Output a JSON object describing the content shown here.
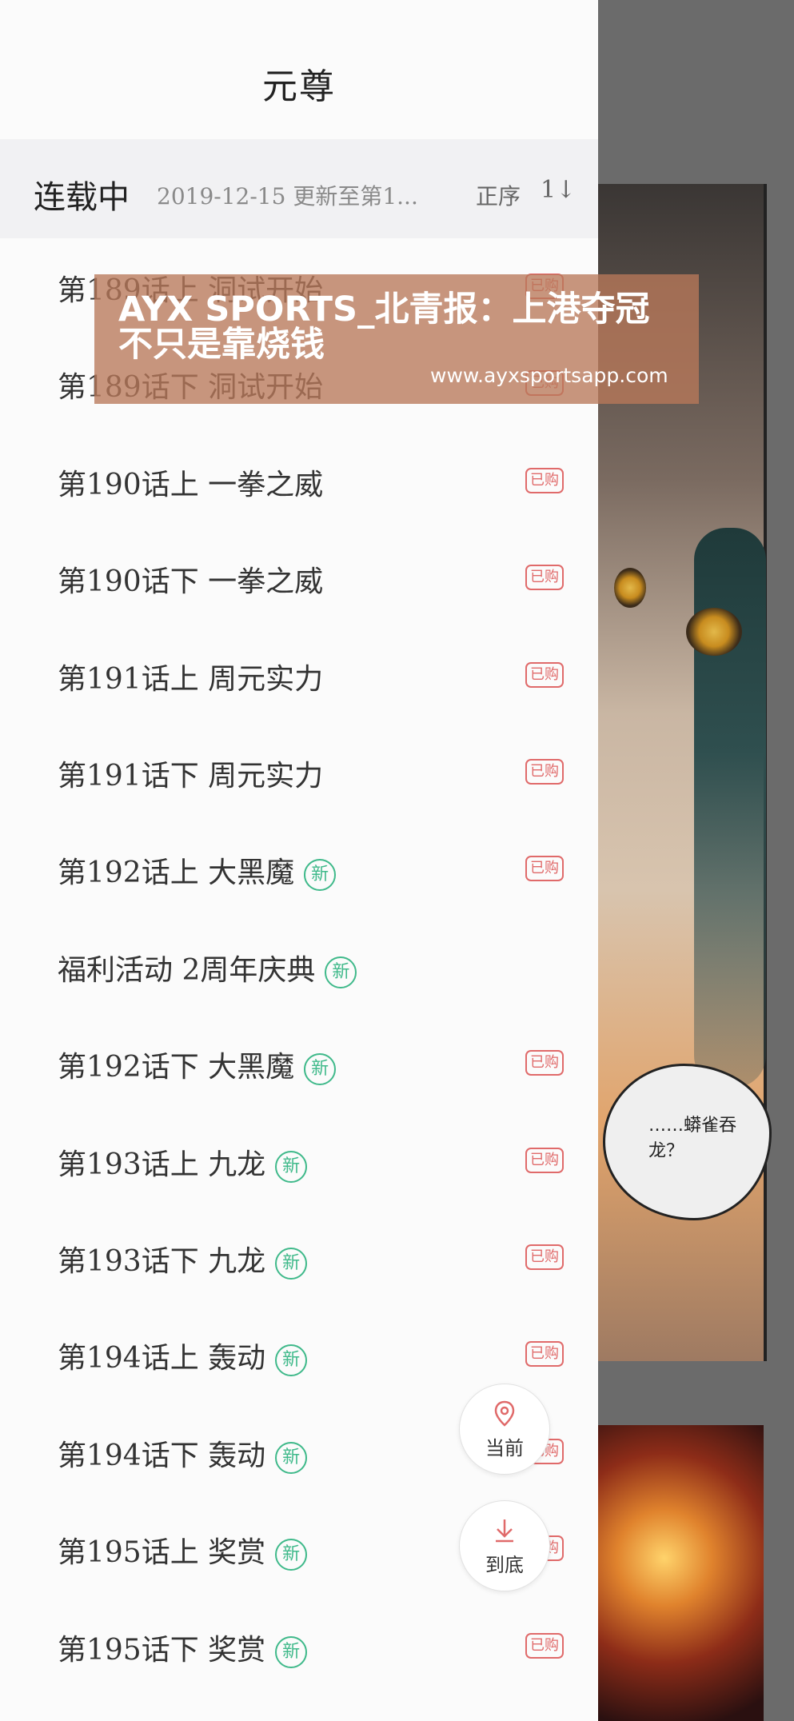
{
  "header": {
    "title": "元尊"
  },
  "status": {
    "label": "连载中",
    "info": "2019-12-15 更新至第1...",
    "sort_label": "正序",
    "sort_icon": "1↓"
  },
  "chapters": [
    {
      "title": "第189话上 洞试开始",
      "new": false,
      "badge": "已购"
    },
    {
      "title": "第189话下 洞试开始",
      "new": false,
      "badge": "已购"
    },
    {
      "title": "第190话上 一拳之威",
      "new": false,
      "badge": "已购"
    },
    {
      "title": "第190话下 一拳之威",
      "new": false,
      "badge": "已购"
    },
    {
      "title": "第191话上 周元实力",
      "new": false,
      "badge": "已购"
    },
    {
      "title": "第191话下 周元实力",
      "new": false,
      "badge": "已购"
    },
    {
      "title": "第192话上 大黑魔",
      "new": true,
      "badge": "已购"
    },
    {
      "title": "福利活动 2周年庆典",
      "new": true,
      "badge": ""
    },
    {
      "title": "第192话下 大黑魔",
      "new": true,
      "badge": "已购"
    },
    {
      "title": "第193话上 九龙",
      "new": true,
      "badge": "已购"
    },
    {
      "title": "第193话下 九龙",
      "new": true,
      "badge": "已购"
    },
    {
      "title": "第194话上 轰动",
      "new": true,
      "badge": "已购"
    },
    {
      "title": "第194话下 轰动",
      "new": true,
      "badge": "已购"
    },
    {
      "title": "第195话上 奖赏",
      "new": true,
      "badge": "已购"
    },
    {
      "title": "第195话下 奖赏",
      "new": true,
      "badge": "已购"
    }
  ],
  "new_badge_text": "新",
  "buttons": {
    "current": "当前",
    "bottom": "到底"
  },
  "banner": {
    "title": "AYX SPORTS_北青报：上港夺冠不只是靠烧钱",
    "url": "www.ayxsportsapp.com"
  },
  "comic": {
    "bubble": "……蟒雀吞龙？"
  },
  "colors": {
    "new_badge": "#3fb98a",
    "bought_badge": "#e06a6a"
  }
}
